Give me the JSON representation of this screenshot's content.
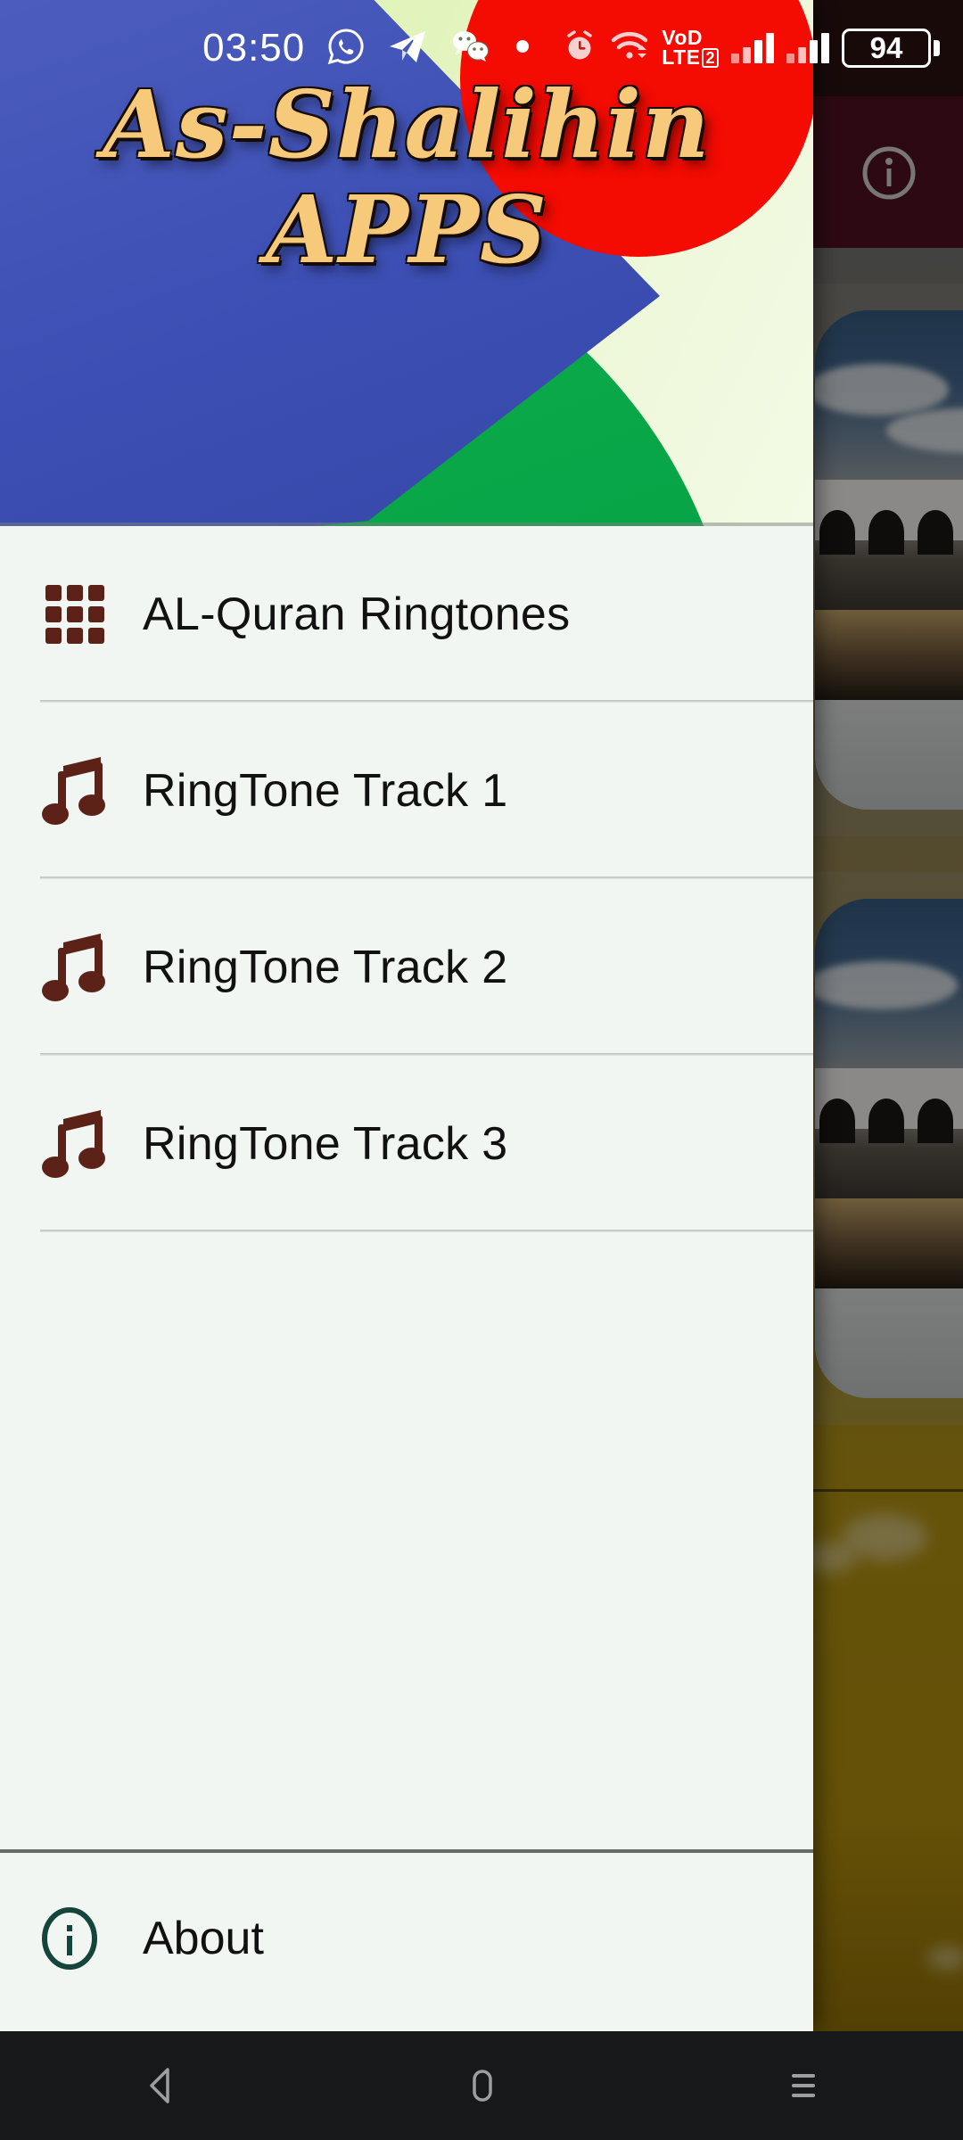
{
  "status_bar": {
    "time": "03:50",
    "left_icons": [
      {
        "name": "whatsapp-icon",
        "label": "WhatsApp"
      },
      {
        "name": "telegram-icon",
        "label": "Telegram"
      },
      {
        "name": "wechat-icon",
        "label": "WeChat"
      },
      {
        "name": "notification-dot-icon",
        "label": "Notification"
      }
    ],
    "right_icons": [
      {
        "name": "alarm-icon",
        "label": "Alarm"
      },
      {
        "name": "wifi-icon",
        "label": "Wi-Fi"
      }
    ],
    "volte_line1": "VoD",
    "volte_line2": "LTE",
    "volte_sim": "2",
    "signal_sim1": "signal-bars-sim1",
    "signal_sim2": "signal-bars-sim2",
    "battery_percent": "94"
  },
  "drawer": {
    "banner": {
      "title_line1": "As-Shalihin",
      "title_line2": "APPS",
      "colors": {
        "title_fill": "#f7c97a",
        "title_shadow": "#150c05",
        "background": "#e2f4bd",
        "blue_wedge": "#3d4fb4",
        "green_circle": "#06a346",
        "red_circle": "#f40b02"
      }
    },
    "items": [
      {
        "label": "AL-Quran Ringtones",
        "icon": "grid-icon",
        "name": "drawer-item-al-quran-ringtones"
      },
      {
        "label": "RingTone Track 1",
        "icon": "music-note-icon",
        "name": "drawer-item-ringtone-track-1"
      },
      {
        "label": "RingTone Track 2",
        "icon": "music-note-icon",
        "name": "drawer-item-ringtone-track-2"
      },
      {
        "label": "RingTone Track 3",
        "icon": "music-note-icon",
        "name": "drawer-item-ringtone-track-3"
      }
    ],
    "footer": {
      "label": "About",
      "icon": "info-circle-icon"
    },
    "colors": {
      "surface": "#f1f6f3",
      "icon_brown": "#5c2218",
      "icon_green": "#14443a",
      "text": "#111111",
      "divider": "#b9c0bd"
    }
  },
  "background_app": {
    "app_bar_color": "#4c1220",
    "info_icon": "info-circle-icon",
    "content": "mosque-photo-cards"
  },
  "nav_bar": {
    "buttons": [
      {
        "name": "nav-back-button",
        "icon": "back-triangle-icon"
      },
      {
        "name": "nav-home-button",
        "icon": "home-rounded-rect-icon"
      },
      {
        "name": "nav-recents-button",
        "icon": "recents-hamburger-icon"
      }
    ],
    "background": "#17181a"
  }
}
